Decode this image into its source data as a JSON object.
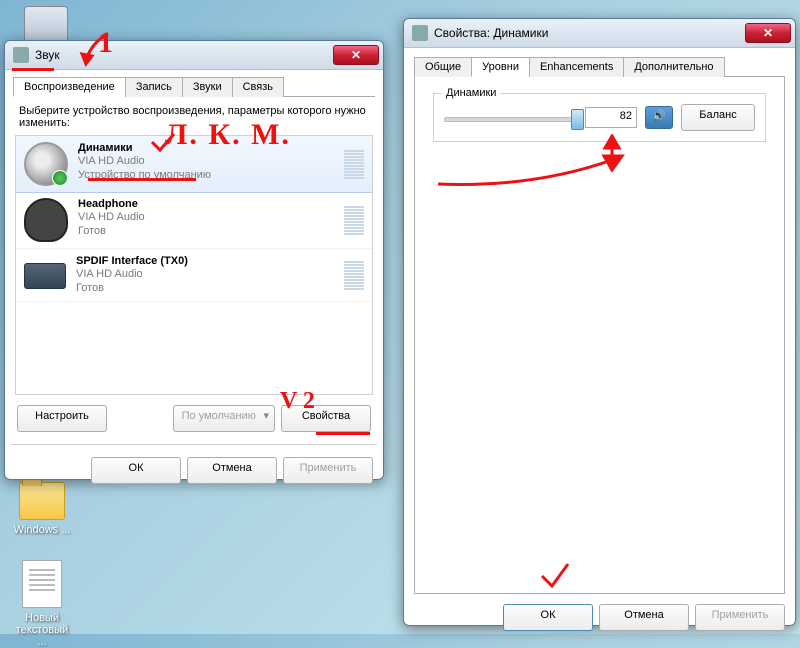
{
  "desktop": {
    "gadget_label": "",
    "windows_label": "Windows ...",
    "txt_label": "Новый текстовый ..."
  },
  "sound_window": {
    "title": "Звук",
    "tabs": [
      "Воспроизведение",
      "Запись",
      "Звуки",
      "Связь"
    ],
    "active_tab": 0,
    "instruction": "Выберите устройство воспроизведения, параметры которого нужно изменить:",
    "devices": [
      {
        "name": "Динамики",
        "sub1": "VIA HD Audio",
        "sub2": "Устройство по умолчанию",
        "default": true
      },
      {
        "name": "Headphone",
        "sub1": "VIA HD Audio",
        "sub2": "Готов",
        "default": false
      },
      {
        "name": "SPDIF Interface (TX0)",
        "sub1": "VIA HD Audio",
        "sub2": "Готов",
        "default": false
      }
    ],
    "configure_btn": "Настроить",
    "default_btn": "По умолчанию",
    "properties_btn": "Свойства",
    "ok": "ОК",
    "cancel": "Отмена",
    "apply": "Применить"
  },
  "properties_window": {
    "title": "Свойства: Динамики",
    "tabs": [
      "Общие",
      "Уровни",
      "Enhancements",
      "Дополнительно"
    ],
    "active_tab": 1,
    "group_label": "Динамики",
    "volume": 82,
    "balance_btn": "Баланс",
    "ok": "ОК",
    "cancel": "Отмена",
    "apply": "Применить"
  },
  "annotations": {
    "n1": "1",
    "lkm": "Л. К. М.",
    "v2": "V 2"
  }
}
